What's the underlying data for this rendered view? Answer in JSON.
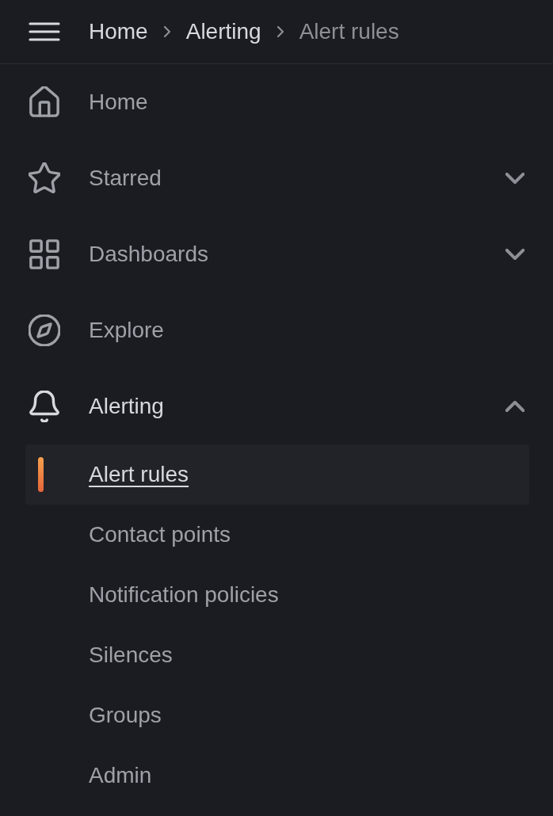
{
  "header": {
    "breadcrumbs": [
      {
        "label": "Home",
        "current": false
      },
      {
        "label": "Alerting",
        "current": false
      },
      {
        "label": "Alert rules",
        "current": true
      }
    ]
  },
  "nav": {
    "items": [
      {
        "label": "Home",
        "active": false
      },
      {
        "label": "Starred",
        "active": false,
        "expanded": false
      },
      {
        "label": "Dashboards",
        "active": false,
        "expanded": false
      },
      {
        "label": "Explore",
        "active": false
      },
      {
        "label": "Alerting",
        "active": true,
        "expanded": true,
        "children": [
          {
            "label": "Alert rules",
            "selected": true
          },
          {
            "label": "Contact points",
            "selected": false
          },
          {
            "label": "Notification policies",
            "selected": false
          },
          {
            "label": "Silences",
            "selected": false
          },
          {
            "label": "Groups",
            "selected": false
          },
          {
            "label": "Admin",
            "selected": false
          }
        ]
      }
    ]
  }
}
